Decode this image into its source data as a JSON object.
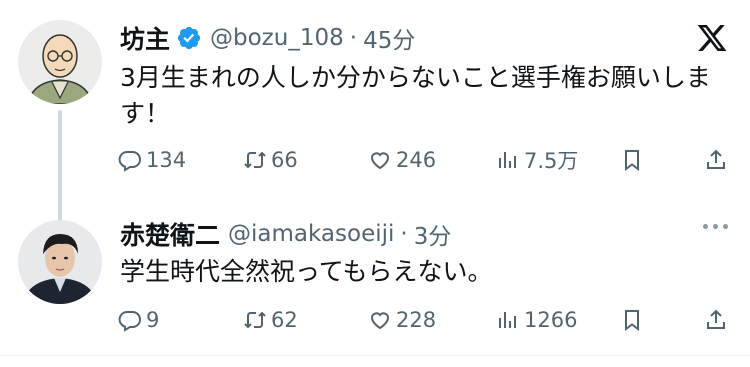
{
  "tweets": [
    {
      "author_name": "坊主",
      "handle": "@bozu_108",
      "separator": "·",
      "time": "45分",
      "verified": true,
      "text": "3月生まれの人しか分からないこと選手権お願いします！",
      "replies": "134",
      "retweets": "66",
      "likes": "246",
      "views": "7.5万"
    },
    {
      "author_name": "赤楚衛二",
      "handle": "@iamakasoeiji",
      "separator": "·",
      "time": "3分",
      "verified": false,
      "text": "学生時代全然祝ってもらえない。",
      "replies": "9",
      "retweets": "62",
      "likes": "228",
      "views": "1266"
    }
  ],
  "colors": {
    "verified": "#1d9bf0",
    "muted": "#536471",
    "thread_line": "#cfd9de"
  },
  "icons": [
    "x-logo-icon",
    "verified-badge-icon",
    "reply-icon",
    "retweet-icon",
    "like-icon",
    "views-icon",
    "bookmark-icon",
    "share-icon",
    "more-icon"
  ]
}
